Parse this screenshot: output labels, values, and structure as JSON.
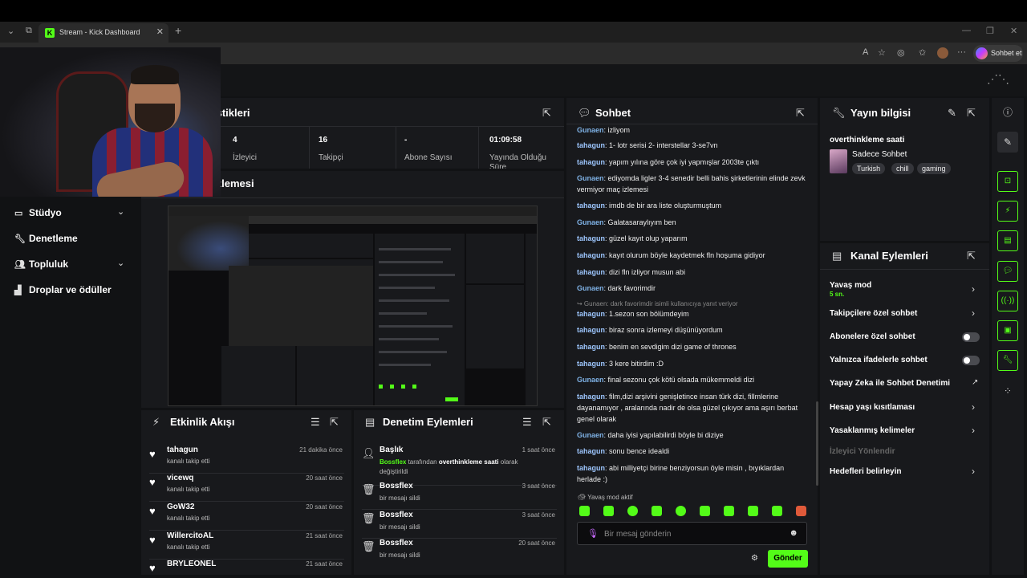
{
  "browser": {
    "tab_title": "Stream - Kick Dashboard",
    "tab_favicon": "K",
    "sohbet_et": "Sohbet et"
  },
  "stats": {
    "title": "istikleri",
    "cells": [
      {
        "value": "4",
        "label": "İzleyici"
      },
      {
        "value": "16",
        "label": "Takipçi"
      },
      {
        "value": "-",
        "label": "Abone Sayısı"
      },
      {
        "value": "01:09:58",
        "label": "Yayında Olduğu Süre"
      }
    ]
  },
  "preview": {
    "title": "izlemesi"
  },
  "nav": {
    "studio": "Stüdyo",
    "moderation": "Denetleme",
    "community": "Topluluk",
    "drops": "Droplar ve ödüller"
  },
  "activity": {
    "title": "Etkinlik Akışı",
    "items": [
      {
        "user": "tahagun",
        "sub": "kanalı takip etti",
        "time": "21 dakika önce"
      },
      {
        "user": "vicewq",
        "sub": "kanalı takip etti",
        "time": "20 saat önce"
      },
      {
        "user": "GoW32",
        "sub": "kanalı takip etti",
        "time": "20 saat önce"
      },
      {
        "user": "WillercitoAL",
        "sub": "kanalı takip etti",
        "time": "21 saat önce"
      },
      {
        "user": "BRYLEONEL",
        "sub": "",
        "time": "21 saat önce"
      }
    ]
  },
  "modlog": {
    "title": "Denetim Eylemleri",
    "first": {
      "user": "Başlık",
      "time": "1 saat önce",
      "actor": "Bossflex",
      "mid": " tarafından ",
      "target": "overthinkleme saati",
      "end": " olarak değiştirildi"
    },
    "items": [
      {
        "user": "Bossflex",
        "sub": "bir mesajı sildi",
        "time": "3 saat önce"
      },
      {
        "user": "Bossflex",
        "sub": "bir mesajı sildi",
        "time": "3 saat önce"
      },
      {
        "user": "Bossflex",
        "sub": "bir mesajı sildi",
        "time": "20 saat önce"
      }
    ]
  },
  "chat": {
    "title": "Sohbet",
    "messages": [
      {
        "user": "Gunaen",
        "text": "izliyom"
      },
      {
        "user": "tahagun",
        "text": "1- lotr serisi 2- interstellar 3-se7vn"
      },
      {
        "user": "tahagun",
        "text": "yapım yılına göre çok iyi yapmışlar 2003te çıktı"
      },
      {
        "user": "Gunaen",
        "text": "ediyomda ligler 3-4 senedir belli bahis şirketlerinin elinde zevk vermiyor maç izlemesi"
      },
      {
        "user": "tahagun",
        "text": "imdb de bir ara liste oluşturmuştum"
      },
      {
        "user": "Gunaen",
        "text": "Galatasaraylıyım ben"
      },
      {
        "user": "tahagun",
        "text": "güzel kayıt olup yaparım"
      },
      {
        "user": "tahagun",
        "text": "kayıt olurum böyle kaydetmek fln hoşuma gidiyor"
      },
      {
        "user": "tahagun",
        "text": "dizi fln izliyor musun abi"
      },
      {
        "user": "Gunaen",
        "text": "dark favorimdir"
      },
      {
        "user": "tahagun",
        "text": "1.sezon son bölümdeyim"
      },
      {
        "user": "tahagun",
        "text": "biraz sonra izlemeyi düşünüyordum"
      },
      {
        "user": "tahagun",
        "text": "benim en sevdigim dizi game of thrones"
      },
      {
        "user": "tahagun",
        "text": "3 kere bitirdim :D"
      },
      {
        "user": "Gunaen",
        "text": "final sezonu çok kötü olsada mükemmeldi dizi"
      },
      {
        "user": "tahagun",
        "text": "film,dizi arşivini genişletince insan türk dizi, fillmlerine dayanamıyor , aralarında nadir de olsa güzel çıkıyor ama aşırı berbat genel olarak"
      },
      {
        "user": "Gunaen",
        "text": "daha iyisi yapılabilirdi böyle bi diziye"
      },
      {
        "user": "tahagun",
        "text": "sonu bence idealdi"
      },
      {
        "user": "tahagun",
        "text": "abi milliyetçi birine benziyorsun öyle misin , bıyıklardan herlade :)"
      }
    ],
    "reply_text": "↪ Gunaen: dark favorimdir isimli kullanıcıya yanıt veriyor",
    "slow_mode": "Yavaş mod aktif",
    "placeholder": "Bir mesaj gönderin",
    "send": "Gönder"
  },
  "stream_info": {
    "title": "Yayın bilgisi",
    "stream_title": "overthinkleme saati",
    "category": "Sadece Sohbet",
    "tags": [
      "Turkish",
      "chill",
      "gaming"
    ]
  },
  "channel_actions": {
    "title": "Kanal Eylemleri",
    "slow": "Yavaş mod",
    "slow_value": "5 sn.",
    "followers_only": "Takipçilere özel sohbet",
    "subs_only": "Abonelere özel sohbet",
    "emotes_only": "Yalnızca ifadelerle sohbet",
    "ai_mod": "Yapay Zeka ile Sohbet Denetimi",
    "account_age": "Hesap yaşı kısıtlaması",
    "banned_words": "Yasaklanmış kelimeler",
    "viewer_redirect": "İzleyici Yönlendir",
    "goals": "Hedefleri belirleyin"
  },
  "colors": {
    "accent": "#53fc18",
    "panel": "#18191c",
    "bg": "#111214"
  }
}
